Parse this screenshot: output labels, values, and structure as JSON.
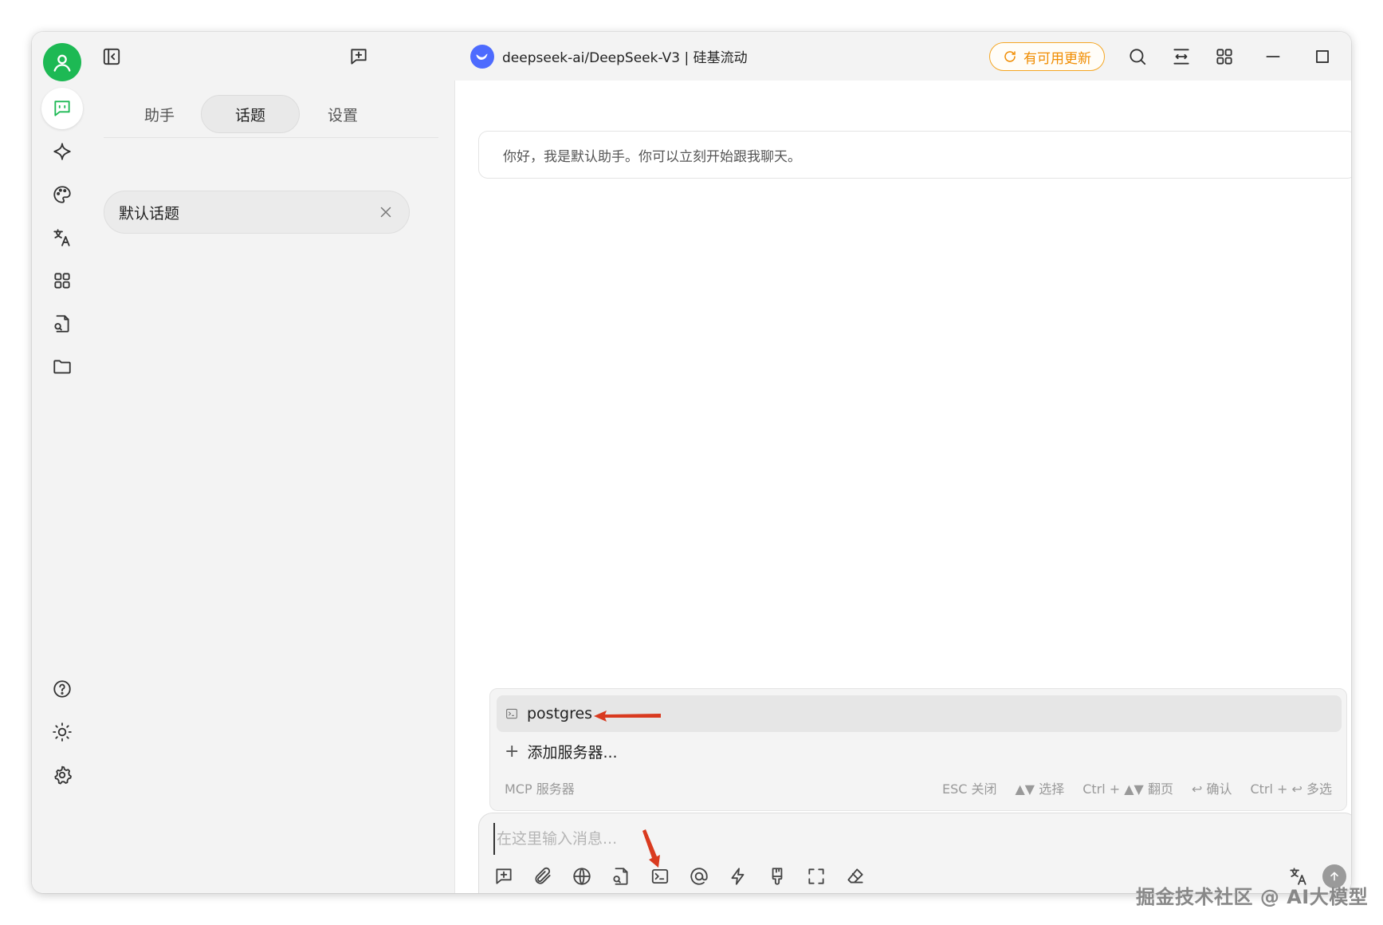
{
  "titlebar": {
    "model_title": "deepseek-ai/DeepSeek-V3 | 硅基流动",
    "update_label": "有可用更新"
  },
  "sidebar": {
    "icons": [
      "chat-icon",
      "sparkle-icon",
      "palette-icon",
      "translate-icon",
      "apps-icon",
      "file-search-icon",
      "folder-icon",
      "help-icon",
      "sun-icon",
      "gear-icon"
    ]
  },
  "panel": {
    "tabs": [
      {
        "label": "助手"
      },
      {
        "label": "话题"
      },
      {
        "label": "设置"
      }
    ],
    "active_tab": "话题",
    "topics": [
      {
        "label": "默认话题"
      }
    ]
  },
  "chat": {
    "greeting": "你好，我是默认助手。你可以立刻开始跟我聊天。"
  },
  "mcp_popup": {
    "servers": [
      {
        "label": "postgres"
      }
    ],
    "add_label": "添加服务器...",
    "footer_title": "MCP 服务器",
    "hints": [
      "ESC 关闭",
      "▲▼ 选择",
      "Ctrl + ▲▼ 翻页",
      "↩ 确认",
      "Ctrl + ↩ 多选"
    ]
  },
  "input": {
    "placeholder": "在这里输入消息..."
  },
  "colors": {
    "accent": "#1db954",
    "update": "#f08c00",
    "annotation": "#d93a1f"
  },
  "watermark": "掘金技术社区 @ AI大模型"
}
